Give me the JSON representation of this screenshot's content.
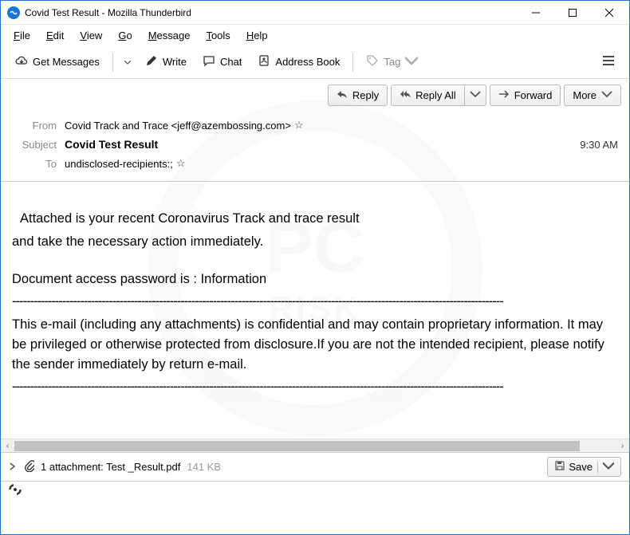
{
  "window": {
    "title": "Covid Test Result - Mozilla Thunderbird"
  },
  "menubar": {
    "file": "File",
    "edit": "Edit",
    "view": "View",
    "go": "Go",
    "message": "Message",
    "tools": "Tools",
    "help": "Help"
  },
  "toolbar": {
    "get_messages": "Get Messages",
    "write": "Write",
    "chat": "Chat",
    "address_book": "Address Book",
    "tag": "Tag"
  },
  "actions": {
    "reply": "Reply",
    "reply_all": "Reply All",
    "forward": "Forward",
    "more": "More"
  },
  "headers": {
    "from_label": "From",
    "from_value": "Covid Track and Trace <jeff@azembossing.com>",
    "subject_label": "Subject",
    "subject_value": "Covid Test Result",
    "to_label": "To",
    "to_value": "undisclosed-recipients:;",
    "time": "9:30 AM"
  },
  "body": {
    "p1a": " Attached is your recent Coronavirus Track and trace result ",
    "p1b": "and take the necessary action immediately.",
    "p2": "Document access password is : Information",
    "sep": "-----------------------------------------------------------------------------------------------------------------------------------------",
    "p3": "This e-mail (including any attachments) is confidential and may contain proprietary information. It may be privileged or otherwise protected from disclosure.If you are not the intended recipient, please notify the sender immediately by return e-mail."
  },
  "attachment": {
    "summary": "1 attachment: ",
    "filename": "Test _Result.pdf",
    "size": "141 KB",
    "save": "Save"
  }
}
